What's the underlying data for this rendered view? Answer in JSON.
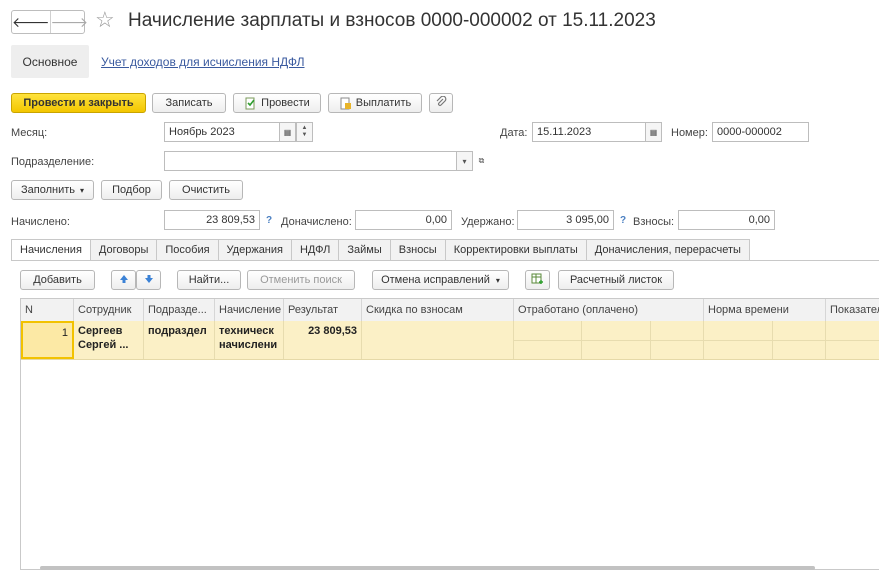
{
  "window": {
    "title": "Начисление зарплаты и взносов 0000-000002 от 15.11.2023"
  },
  "nav": {
    "back": "🡐",
    "forward": "🡒",
    "favorite": "☆"
  },
  "sections": {
    "main": "Основное",
    "ndfl_link": "Учет доходов для исчисления НДФЛ"
  },
  "toolbar": {
    "post_close": "Провести и закрыть",
    "save": "Записать",
    "post": "Провести",
    "pay": "Выплатить"
  },
  "form": {
    "month_label": "Месяц:",
    "month_value": "Ноябрь 2023",
    "date_label": "Дата:",
    "date_value": "15.11.2023",
    "number_label": "Номер:",
    "number_value": "0000-000002",
    "dept_label": "Подразделение:",
    "dept_value": ""
  },
  "actions": {
    "fill": "Заполнить",
    "pick": "Подбор",
    "clear": "Очистить"
  },
  "totals": {
    "accrued_label": "Начислено:",
    "accrued_value": "23 809,53",
    "extra_label": "Доначислено:",
    "extra_value": "0,00",
    "withheld_label": "Удержано:",
    "withheld_value": "3 095,00",
    "contrib_label": "Взносы:",
    "contrib_value": "0,00",
    "hint": "?"
  },
  "tabs": [
    {
      "label": "Начисления"
    },
    {
      "label": "Договоры"
    },
    {
      "label": "Пособия"
    },
    {
      "label": "Удержания"
    },
    {
      "label": "НДФЛ"
    },
    {
      "label": "Займы"
    },
    {
      "label": "Взносы"
    },
    {
      "label": "Корректировки выплаты"
    },
    {
      "label": "Доначисления, перерасчеты"
    }
  ],
  "grid_toolbar": {
    "add": "Добавить",
    "find": "Найти...",
    "cancel_search": "Отменить поиск",
    "cancel_corrections": "Отмена исправлений",
    "payslip": "Расчетный листок"
  },
  "grid": {
    "columns": [
      "N",
      "Сотрудник",
      "Подразде...",
      "Начисление",
      "Результат",
      "Скидка по взносам",
      "Отработано (оплачено)",
      "Норма времени",
      "Показател"
    ],
    "rows": [
      {
        "n": "1",
        "employee": "Сергеев Сергей ...",
        "dept": "подраздел",
        "accrual": "техническ начислени",
        "result": "23 809,53"
      }
    ]
  },
  "colors": {
    "primary_button": "#f3c600",
    "selected_row": "#fbf0c6",
    "hint": "#4a7fc1",
    "link": "#3a5a9f"
  }
}
